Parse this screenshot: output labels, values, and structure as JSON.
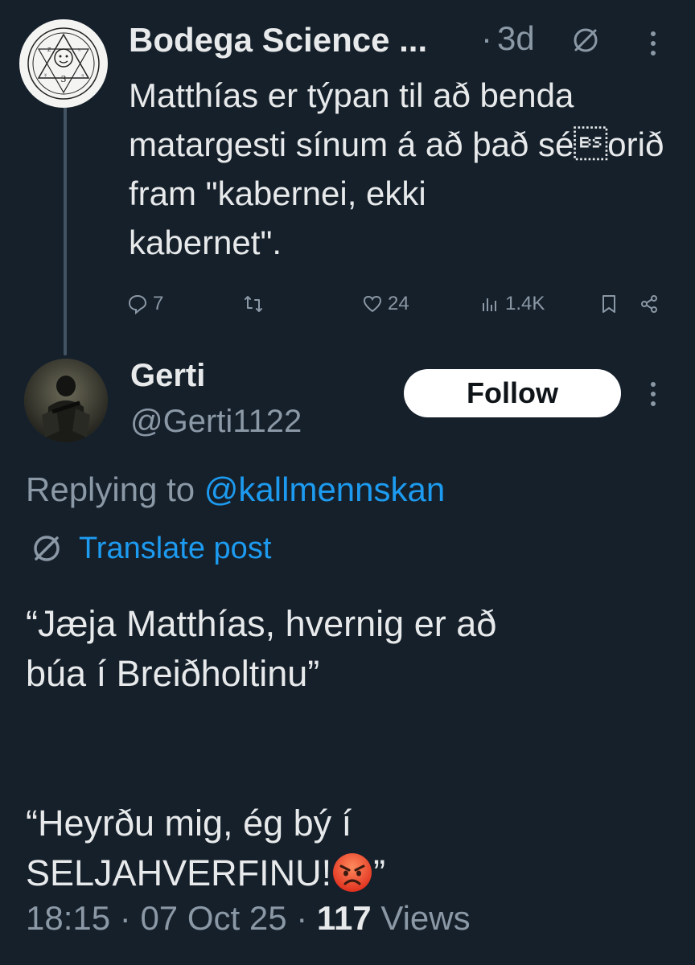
{
  "parent_tweet": {
    "author_name": "Bodega Science ...",
    "age": "3d",
    "separator": "·",
    "text": "Matthías er týpan til að benda\nmatargesti sínum á að það sé\borið fram \"kabernei, ekki\nkabernet\".",
    "actions": {
      "replies": "7",
      "likes": "24",
      "views": "1.4K"
    },
    "icons": [
      "globe-icon",
      "more-icon",
      "reply-icon",
      "retweet-icon",
      "like-icon",
      "views-icon",
      "bookmark-icon",
      "share-icon"
    ]
  },
  "main_tweet": {
    "author_name": "Gerti",
    "handle": "@Gerti1122",
    "follow_label": "Follow",
    "replying_prefix": "Replying to ",
    "replying_mention": "@kallmennskan",
    "translate_label": "Translate post",
    "text_line1": "“Jæja Matthías, hvernig er að\nbúa í Breiðholtinu”\n\n\n“Heyrðu mig, ég bý í\nSELJAHVERFINU!",
    "text_after_emoji": "”",
    "emoji": "angry-face-emoji",
    "time": "18:15",
    "date": "07 Oct 25",
    "views_count": "117",
    "views_label": "Views",
    "separator": "·"
  },
  "colors": {
    "background": "#15202b",
    "text": "#e7e9ea",
    "muted": "#8b98a5",
    "accent": "#1d9bf0",
    "follow_bg": "#ffffff"
  }
}
